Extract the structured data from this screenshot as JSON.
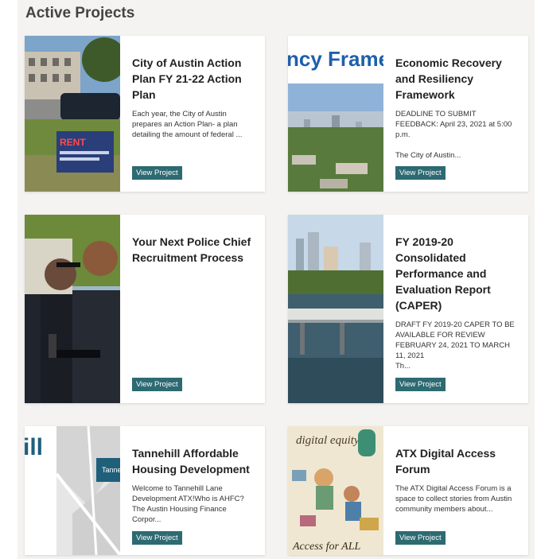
{
  "section_title": "Active Projects",
  "cards": [
    {
      "title": "City of Austin Action Plan FY 21-22 Action Plan",
      "desc": [
        "Each year, the City of Austin prepares an Action Plan- a plan detailing the amount of federal ..."
      ],
      "button": "View Project",
      "image_text": "RENT"
    },
    {
      "title": "Economic Recovery and Resiliency Framework",
      "desc": [
        "DEADLINE TO SUBMIT FEEDBACK: April 23, 2021 at 5:00 p.m.",
        "The City of Austin..."
      ],
      "button": "View Project",
      "image_text": "ncy Frame"
    },
    {
      "title": "Your Next Police Chief Recruitment Process",
      "desc": [],
      "button": "View Project"
    },
    {
      "title": "FY 2019-20 Consolidated Performance and Evaluation Report (CAPER)",
      "desc": [
        "DRAFT FY 2019-20 CAPER TO BE AVAILABLE FOR REVIEW FEBRUARY 24, 2021 TO MARCH 11, 2021",
        "Th..."
      ],
      "button": "View Project"
    },
    {
      "title": "Tannehill Affordable Housing Development",
      "desc": [
        "Welcome to Tannehill Lane Development ATX!Who is AHFC? The Austin Housing Finance Corpor..."
      ],
      "button": "View Project",
      "image_text": "ill",
      "map_label": "Tanne"
    },
    {
      "title": "ATX Digital Access Forum",
      "desc": [
        "The ATX Digital Access Forum is a space to collect stories from Austin community members about..."
      ],
      "button": "View Project",
      "image_text_top": "digital equity",
      "image_text_bottom": "Access for ALL"
    }
  ]
}
